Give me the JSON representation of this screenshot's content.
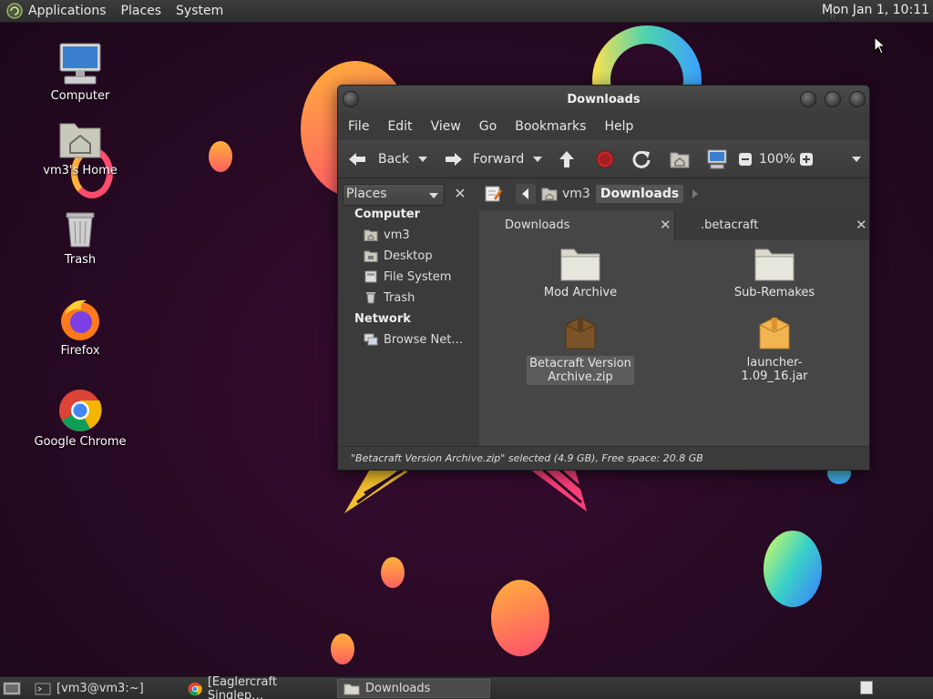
{
  "top_panel": {
    "menus": [
      "Applications",
      "Places",
      "System"
    ],
    "clock": "Mon Jan 1, 10:11"
  },
  "desktop": {
    "icons": [
      {
        "label": "Computer",
        "icon": "computer-icon"
      },
      {
        "label": "vm3's Home",
        "icon": "home-folder-icon"
      },
      {
        "label": "Trash",
        "icon": "trash-icon"
      },
      {
        "label": "Firefox",
        "icon": "firefox-icon"
      },
      {
        "label": "Google Chrome",
        "icon": "chrome-icon"
      }
    ]
  },
  "file_manager": {
    "title": "Downloads",
    "menubar": [
      "File",
      "Edit",
      "View",
      "Go",
      "Bookmarks",
      "Help"
    ],
    "toolbar": {
      "back": "Back",
      "forward": "Forward",
      "zoom": "100%"
    },
    "location": {
      "crumbs": [
        "vm3",
        "Downloads"
      ]
    },
    "sidebar": {
      "combo": "Places",
      "sections": [
        {
          "title": "Computer",
          "items": [
            "vm3",
            "Desktop",
            "File System",
            "Trash"
          ]
        },
        {
          "title": "Network",
          "items": [
            "Browse Net…"
          ]
        }
      ]
    },
    "tabs": [
      "Downloads",
      ".betacraft"
    ],
    "files": [
      {
        "name": "Mod Archive",
        "type": "folder"
      },
      {
        "name": "Sub-Remakes",
        "type": "folder"
      },
      {
        "name_line1": "Betacraft Version",
        "name_line2": "Archive.zip",
        "type": "archive",
        "selected": true
      },
      {
        "name": "launcher-1.09_16.jar",
        "type": "jar"
      }
    ],
    "status": "\"Betacraft Version Archive.zip\" selected (4.9 GB), Free space: 20.8 GB"
  },
  "taskbar": {
    "tasks": [
      "[vm3@vm3:~]",
      "[Eaglercraft Singlep…",
      "Downloads"
    ]
  },
  "colors": {
    "desktop_bg": "#2a0a26",
    "window_bg": "#3b3b3b",
    "content_bg": "#464646",
    "stop_red": "#c0292b"
  }
}
